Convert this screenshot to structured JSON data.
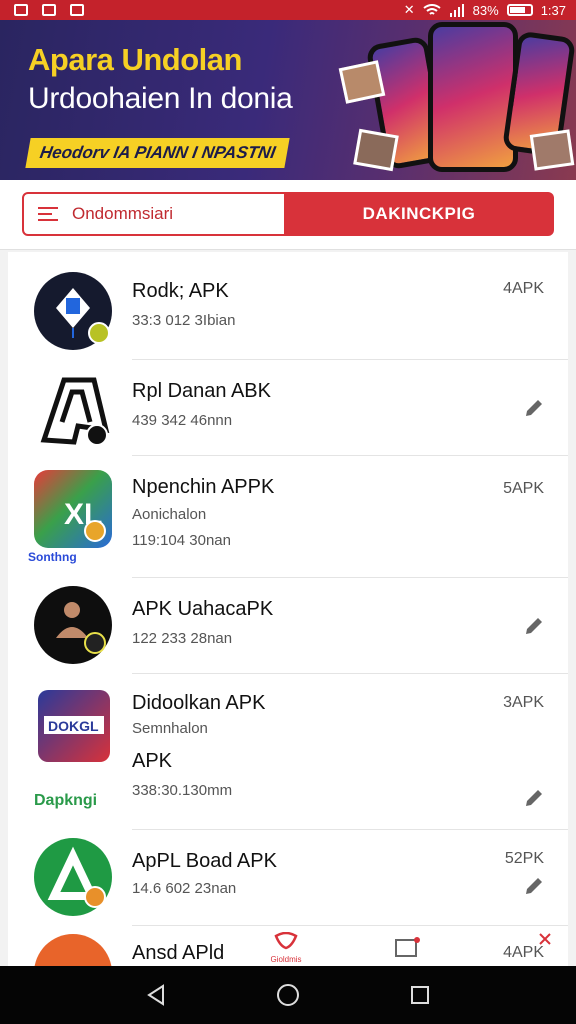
{
  "status_bar": {
    "battery_pct": "83%",
    "time": "1:37"
  },
  "banner": {
    "title": "Apara Undolan",
    "subtitle": "Urdoohaien In donia",
    "tag": "Heodorv IA PIANN I NPASTNI"
  },
  "search": {
    "placeholder": "Ondommsiari",
    "button_label": "DAKINCKPIG"
  },
  "apps": [
    {
      "name": "Rodk; APK",
      "meta": "33:3 012 3Ibian",
      "size": "4APK",
      "action": "size"
    },
    {
      "name": "Rpl Danan ABK",
      "meta": "439 342 46nnn",
      "size": "",
      "action": "edit"
    },
    {
      "name": "Npenchin APPK",
      "subtitle": "Aonichalon",
      "meta": "119:104 30nan",
      "size": "5APK",
      "action": "size",
      "caption": "Sonthng"
    },
    {
      "name": "APK UahacaPK",
      "meta": "122 233 28nan",
      "size": "",
      "action": "edit"
    },
    {
      "name": "Didoolkan APK",
      "subtitle": "Semnhalon",
      "extra": "APK",
      "meta": "338:30.130mm",
      "size": "3APK",
      "action": "size_edit",
      "caption": "Dapkngi"
    },
    {
      "name": "ApPL Boad APK",
      "meta": "14.6 602 23nan",
      "size": "52PK",
      "action": "size_edit"
    },
    {
      "name": "Ansd APld",
      "size": "4APK",
      "action": "size",
      "mid_label": "Gioldmis"
    }
  ],
  "icons": [
    "app-icon-kite",
    "app-icon-a-logo",
    "app-icon-xl",
    "app-icon-person",
    "app-icon-dokg",
    "app-icon-green-a",
    "app-icon-orange"
  ],
  "colors": {
    "accent": "#d8323a",
    "status": "#c4222b",
    "banner_yellow": "#f6d024"
  }
}
